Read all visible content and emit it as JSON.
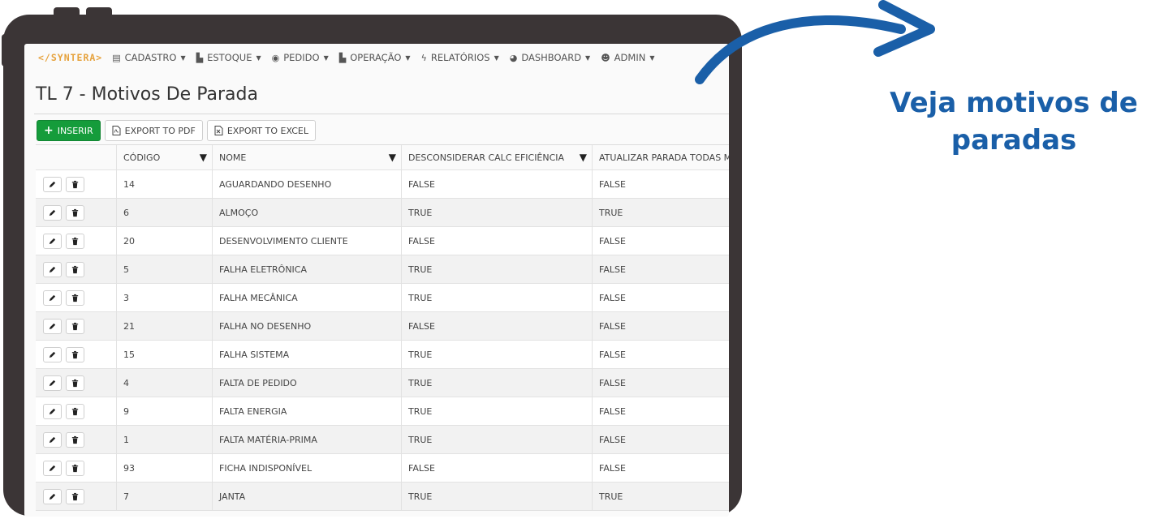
{
  "app": {
    "logo": "</SYNTERA>",
    "nav": [
      {
        "label": "CADASTRO",
        "icon": "id-card-icon"
      },
      {
        "label": "ESTOQUE",
        "icon": "area-chart-icon"
      },
      {
        "label": "PEDIDO",
        "icon": "eye-icon"
      },
      {
        "label": "OPERAÇÃO",
        "icon": "area-chart-icon"
      },
      {
        "label": "RELATÓRIOS",
        "icon": "lightning-icon"
      },
      {
        "label": "DASHBOARD",
        "icon": "dashboard-icon"
      },
      {
        "label": "ADMIN",
        "icon": "users-icon"
      }
    ]
  },
  "page": {
    "title": "TL 7 - Motivos De Parada"
  },
  "toolbar": {
    "insert_label": "INSERIR",
    "pdf_label": "EXPORT TO PDF",
    "excel_label": "EXPORT TO EXCEL"
  },
  "table": {
    "columns": [
      "CÓDIGO",
      "NOME",
      "DESCONSIDERAR CALC EFICIÊNCIA",
      "ATUALIZAR PARADA TODAS M"
    ],
    "rows": [
      {
        "codigo": "14",
        "nome": "AGUARDANDO DESENHO",
        "desc": "FALSE",
        "atual": "FALSE"
      },
      {
        "codigo": "6",
        "nome": "ALMOÇO",
        "desc": "TRUE",
        "atual": "TRUE"
      },
      {
        "codigo": "20",
        "nome": "DESENVOLVIMENTO CLIENTE",
        "desc": "FALSE",
        "atual": "FALSE"
      },
      {
        "codigo": "5",
        "nome": "FALHA ELETRÔNICA",
        "desc": "TRUE",
        "atual": "FALSE"
      },
      {
        "codigo": "3",
        "nome": "FALHA MECÂNICA",
        "desc": "TRUE",
        "atual": "FALSE"
      },
      {
        "codigo": "21",
        "nome": "FALHA NO DESENHO",
        "desc": "FALSE",
        "atual": "FALSE"
      },
      {
        "codigo": "15",
        "nome": "FALHA SISTEMA",
        "desc": "TRUE",
        "atual": "FALSE"
      },
      {
        "codigo": "4",
        "nome": "FALTA DE PEDIDO",
        "desc": "TRUE",
        "atual": "FALSE"
      },
      {
        "codigo": "9",
        "nome": "FALTA ENERGIA",
        "desc": "TRUE",
        "atual": "FALSE"
      },
      {
        "codigo": "1",
        "nome": "FALTA MATÉRIA-PRIMA",
        "desc": "TRUE",
        "atual": "FALSE"
      },
      {
        "codigo": "93",
        "nome": "FICHA INDISPONÍVEL",
        "desc": "FALSE",
        "atual": "FALSE"
      },
      {
        "codigo": "7",
        "nome": "JANTA",
        "desc": "TRUE",
        "atual": "TRUE"
      }
    ]
  },
  "annotation": {
    "line1": "Veja motivos de",
    "line2": "paradas",
    "color": "#1a5fa8"
  },
  "colors": {
    "accent_green": "#159c3b",
    "logo": "#e6a23c",
    "frame": "#3b3536"
  }
}
